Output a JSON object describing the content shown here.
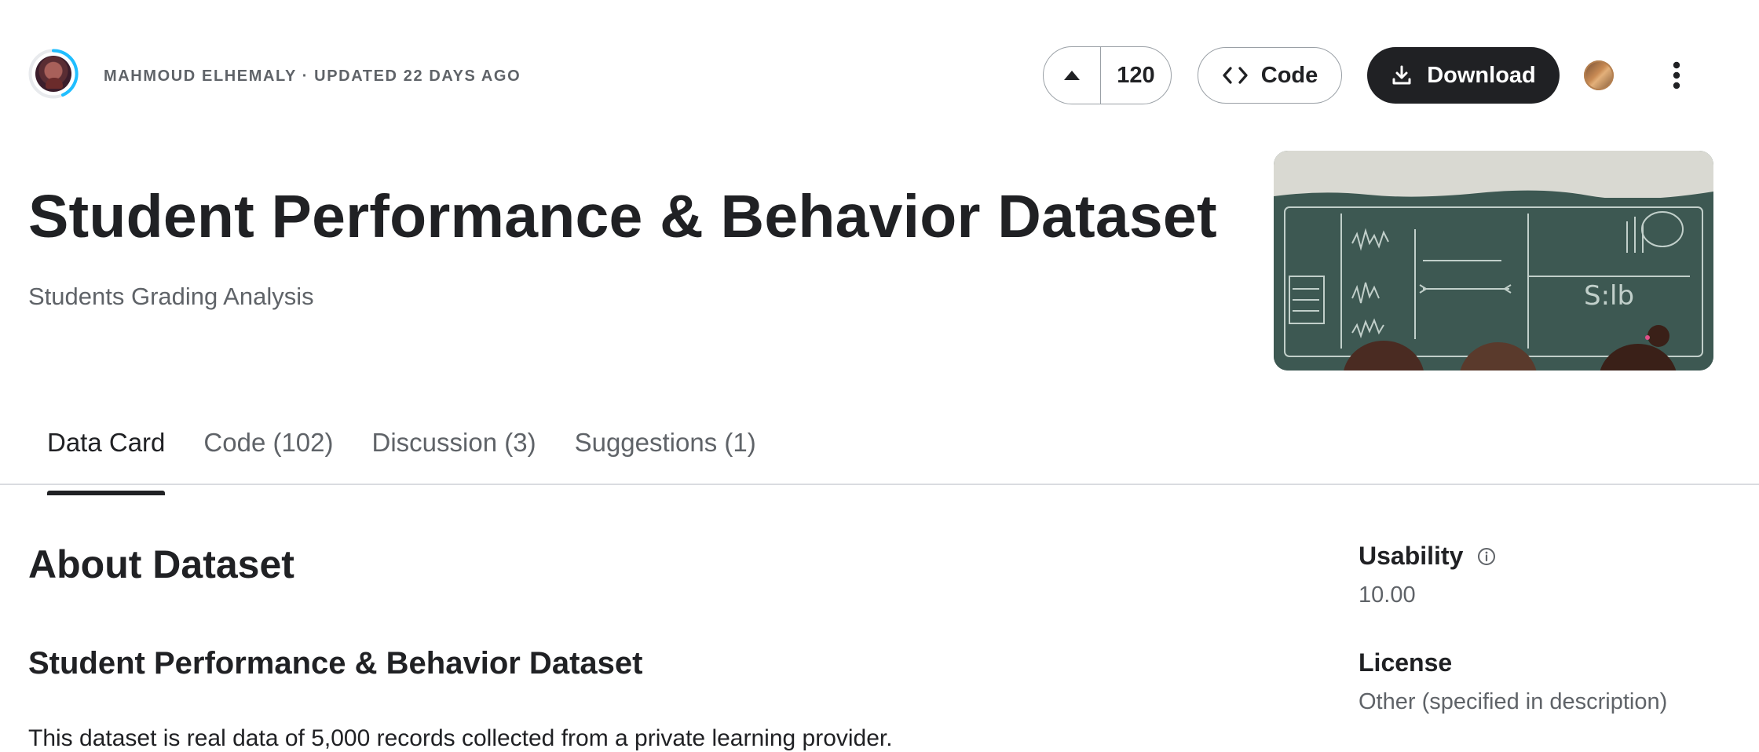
{
  "header": {
    "owner_line": "MAHMOUD ELHEMALY · UPDATED 22 DAYS AGO",
    "vote_count": "120",
    "code_label": "Code",
    "download_label": "Download"
  },
  "dataset": {
    "title": "Student Performance & Behavior Dataset",
    "subtitle": "Students Grading Analysis"
  },
  "tabs": [
    {
      "label": "Data Card",
      "active": true
    },
    {
      "label": "Code (102)",
      "active": false
    },
    {
      "label": "Discussion (3)",
      "active": false
    },
    {
      "label": "Suggestions (1)",
      "active": false
    }
  ],
  "content": {
    "about_heading": "About Dataset",
    "section_heading": "Student Performance & Behavior Dataset",
    "intro_text": "This dataset is real data of 5,000 records collected from a private learning provider."
  },
  "sidebar": {
    "usability_label": "Usability",
    "usability_value": "10.00",
    "license_label": "License",
    "license_value": "Other (specified in description)"
  },
  "icons": {
    "upvote": "caret-up-icon",
    "code": "code-brackets-icon",
    "download": "download-icon",
    "info": "info-icon",
    "more": "vertical-dots-icon"
  },
  "colors": {
    "primary_button": "#202124",
    "ring_accent": "#20beff",
    "muted_text": "#5f6368",
    "border": "#9aa0a6"
  }
}
